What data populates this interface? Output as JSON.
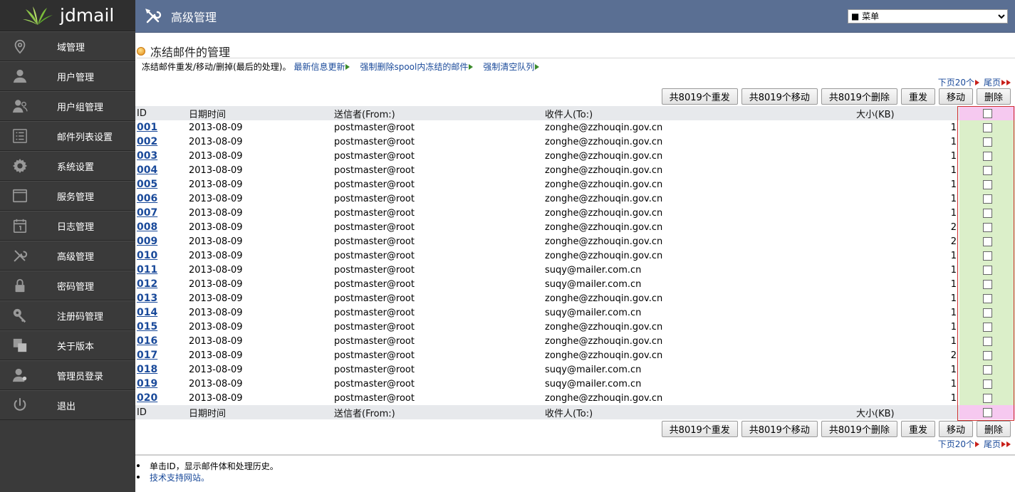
{
  "app": {
    "logo_text": "jdmail"
  },
  "sidebar": {
    "items": [
      {
        "label": "域管理",
        "icon": "map-pin-icon"
      },
      {
        "label": "用户管理",
        "icon": "user-icon"
      },
      {
        "label": "用户组管理",
        "icon": "user-group-icon"
      },
      {
        "label": "邮件列表设置",
        "icon": "list-icon"
      },
      {
        "label": "系统设置",
        "icon": "gear-icon"
      },
      {
        "label": "服务管理",
        "icon": "window-icon"
      },
      {
        "label": "日志管理",
        "icon": "calendar-icon"
      },
      {
        "label": "高级管理",
        "icon": "tools-icon"
      },
      {
        "label": "密码管理",
        "icon": "lock-icon"
      },
      {
        "label": "注册码管理",
        "icon": "key-icon"
      },
      {
        "label": "关于版本",
        "icon": "copy-icon"
      },
      {
        "label": "管理员登录",
        "icon": "admin-user-icon"
      },
      {
        "label": "退出",
        "icon": "power-icon"
      }
    ]
  },
  "header": {
    "title": "高级管理",
    "menu_selected": "■ 菜单"
  },
  "page": {
    "section_title": "冻结邮件的管理",
    "info_text": "冻结邮件重发/移动/删掉(最后的处理)。",
    "links": [
      "最新信息更新",
      "强制删除spool内冻结的邮件",
      "强制清空队列"
    ],
    "pager": {
      "next": "下页20个",
      "last": "尾页"
    },
    "buttons": [
      "共8019个重发",
      "共8019个移动",
      "共8019个删除",
      "重发",
      "移动",
      "删除"
    ]
  },
  "table": {
    "columns": [
      "ID",
      "日期时间",
      "送信者(From:)",
      "收件人(To:)",
      "大小(KB)"
    ],
    "rows": [
      {
        "id": "001",
        "date": "2013-08-09",
        "from": "postmaster@root",
        "to": "zonghe@zzhouqin.gov.cn",
        "size": "1"
      },
      {
        "id": "002",
        "date": "2013-08-09",
        "from": "postmaster@root",
        "to": "zonghe@zzhouqin.gov.cn",
        "size": "1"
      },
      {
        "id": "003",
        "date": "2013-08-09",
        "from": "postmaster@root",
        "to": "zonghe@zzhouqin.gov.cn",
        "size": "1"
      },
      {
        "id": "004",
        "date": "2013-08-09",
        "from": "postmaster@root",
        "to": "zonghe@zzhouqin.gov.cn",
        "size": "1"
      },
      {
        "id": "005",
        "date": "2013-08-09",
        "from": "postmaster@root",
        "to": "zonghe@zzhouqin.gov.cn",
        "size": "1"
      },
      {
        "id": "006",
        "date": "2013-08-09",
        "from": "postmaster@root",
        "to": "zonghe@zzhouqin.gov.cn",
        "size": "1"
      },
      {
        "id": "007",
        "date": "2013-08-09",
        "from": "postmaster@root",
        "to": "zonghe@zzhouqin.gov.cn",
        "size": "1"
      },
      {
        "id": "008",
        "date": "2013-08-09",
        "from": "postmaster@root",
        "to": "zonghe@zzhouqin.gov.cn",
        "size": "2"
      },
      {
        "id": "009",
        "date": "2013-08-09",
        "from": "postmaster@root",
        "to": "zonghe@zzhouqin.gov.cn",
        "size": "2"
      },
      {
        "id": "010",
        "date": "2013-08-09",
        "from": "postmaster@root",
        "to": "zonghe@zzhouqin.gov.cn",
        "size": "1"
      },
      {
        "id": "011",
        "date": "2013-08-09",
        "from": "postmaster@root",
        "to": "suqy@mailer.com.cn",
        "size": "1"
      },
      {
        "id": "012",
        "date": "2013-08-09",
        "from": "postmaster@root",
        "to": "suqy@mailer.com.cn",
        "size": "1"
      },
      {
        "id": "013",
        "date": "2013-08-09",
        "from": "postmaster@root",
        "to": "zonghe@zzhouqin.gov.cn",
        "size": "1"
      },
      {
        "id": "014",
        "date": "2013-08-09",
        "from": "postmaster@root",
        "to": "suqy@mailer.com.cn",
        "size": "1"
      },
      {
        "id": "015",
        "date": "2013-08-09",
        "from": "postmaster@root",
        "to": "zonghe@zzhouqin.gov.cn",
        "size": "1"
      },
      {
        "id": "016",
        "date": "2013-08-09",
        "from": "postmaster@root",
        "to": "zonghe@zzhouqin.gov.cn",
        "size": "1"
      },
      {
        "id": "017",
        "date": "2013-08-09",
        "from": "postmaster@root",
        "to": "zonghe@zzhouqin.gov.cn",
        "size": "2"
      },
      {
        "id": "018",
        "date": "2013-08-09",
        "from": "postmaster@root",
        "to": "suqy@mailer.com.cn",
        "size": "1"
      },
      {
        "id": "019",
        "date": "2013-08-09",
        "from": "postmaster@root",
        "to": "suqy@mailer.com.cn",
        "size": "1"
      },
      {
        "id": "020",
        "date": "2013-08-09",
        "from": "postmaster@root",
        "to": "zonghe@zzhouqin.gov.cn",
        "size": "1"
      }
    ]
  },
  "notes": [
    "单击ID，显示邮件体和处理历史。",
    "技术支持网站。"
  ],
  "colors": {
    "sidebar_bg": "#3a3a3a",
    "header_bg": "#5a6f93",
    "link": "#1a4a9a",
    "check_col": "#dbefc9",
    "check_head": "#f6c9f0"
  }
}
